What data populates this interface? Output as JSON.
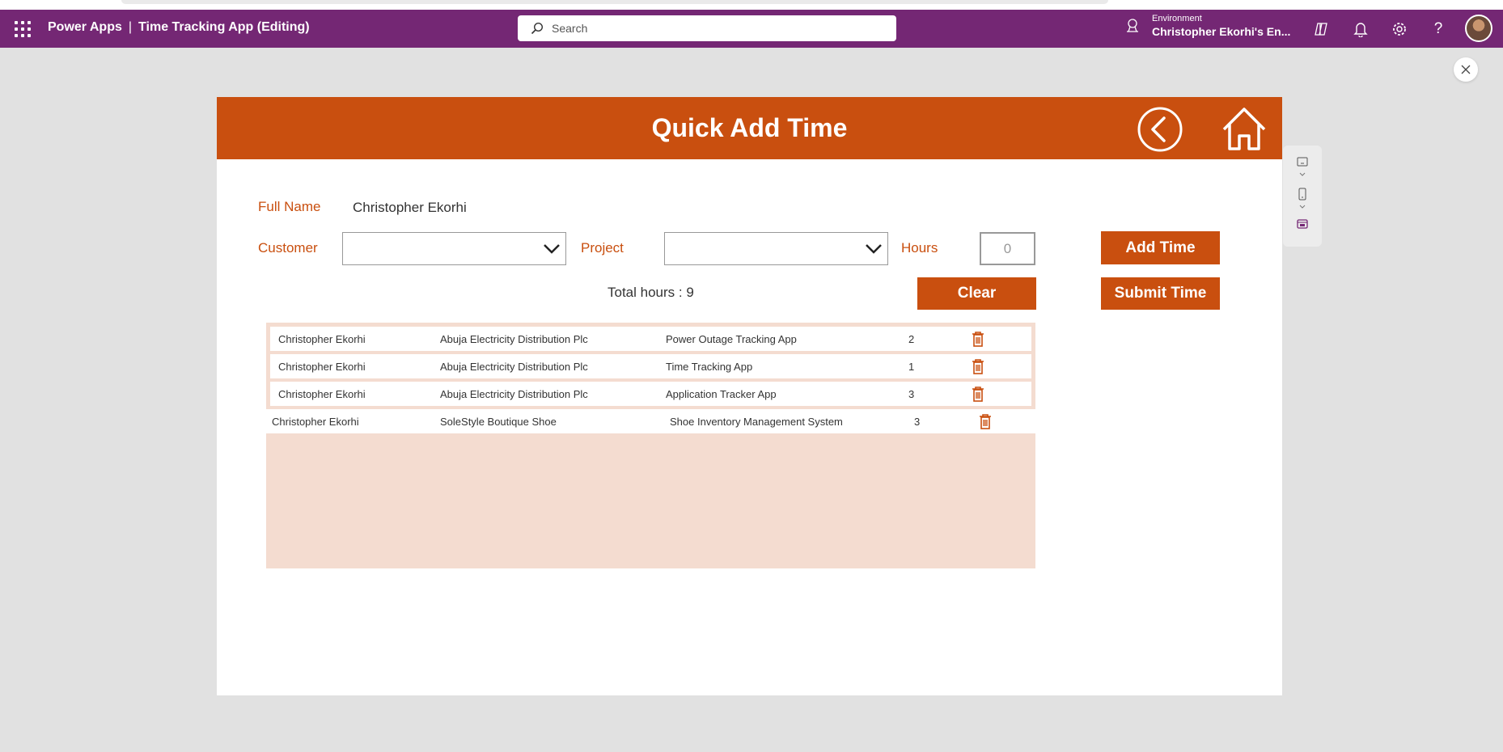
{
  "header": {
    "brand": "Power Apps",
    "separator": "|",
    "app_title": "Time Tracking App (Editing)",
    "search_placeholder": "Search",
    "environment_label": "Environment",
    "environment_name": "Christopher Ekorhi's En...",
    "bg_color": "#742774"
  },
  "screen": {
    "title": "Quick Add Time",
    "accent_color": "#c94f0f",
    "full_name_label": "Full Name",
    "full_name_value": "Christopher Ekorhi",
    "customer_label": "Customer",
    "customer_value": "",
    "project_label": "Project",
    "project_value": "",
    "hours_label": "Hours",
    "hours_value": "0",
    "add_time_label": "Add Time",
    "submit_time_label": "Submit Time",
    "clear_label": "Clear",
    "total_hours_text": "Total hours : 9"
  },
  "entries": [
    {
      "name": "Christopher Ekorhi",
      "customer": "Abuja Electricity Distribution Plc",
      "project": "Power Outage Tracking App",
      "hours": "2"
    },
    {
      "name": "Christopher Ekorhi",
      "customer": "Abuja Electricity Distribution Plc",
      "project": "Time Tracking App",
      "hours": "1"
    },
    {
      "name": "Christopher Ekorhi",
      "customer": "Abuja Electricity Distribution Plc",
      "project": "Application Tracker App",
      "hours": "3"
    },
    {
      "name": "Christopher Ekorhi",
      "customer": "SoleStyle Boutique Shoe",
      "project": "Shoe Inventory Management System",
      "hours": "3"
    }
  ]
}
